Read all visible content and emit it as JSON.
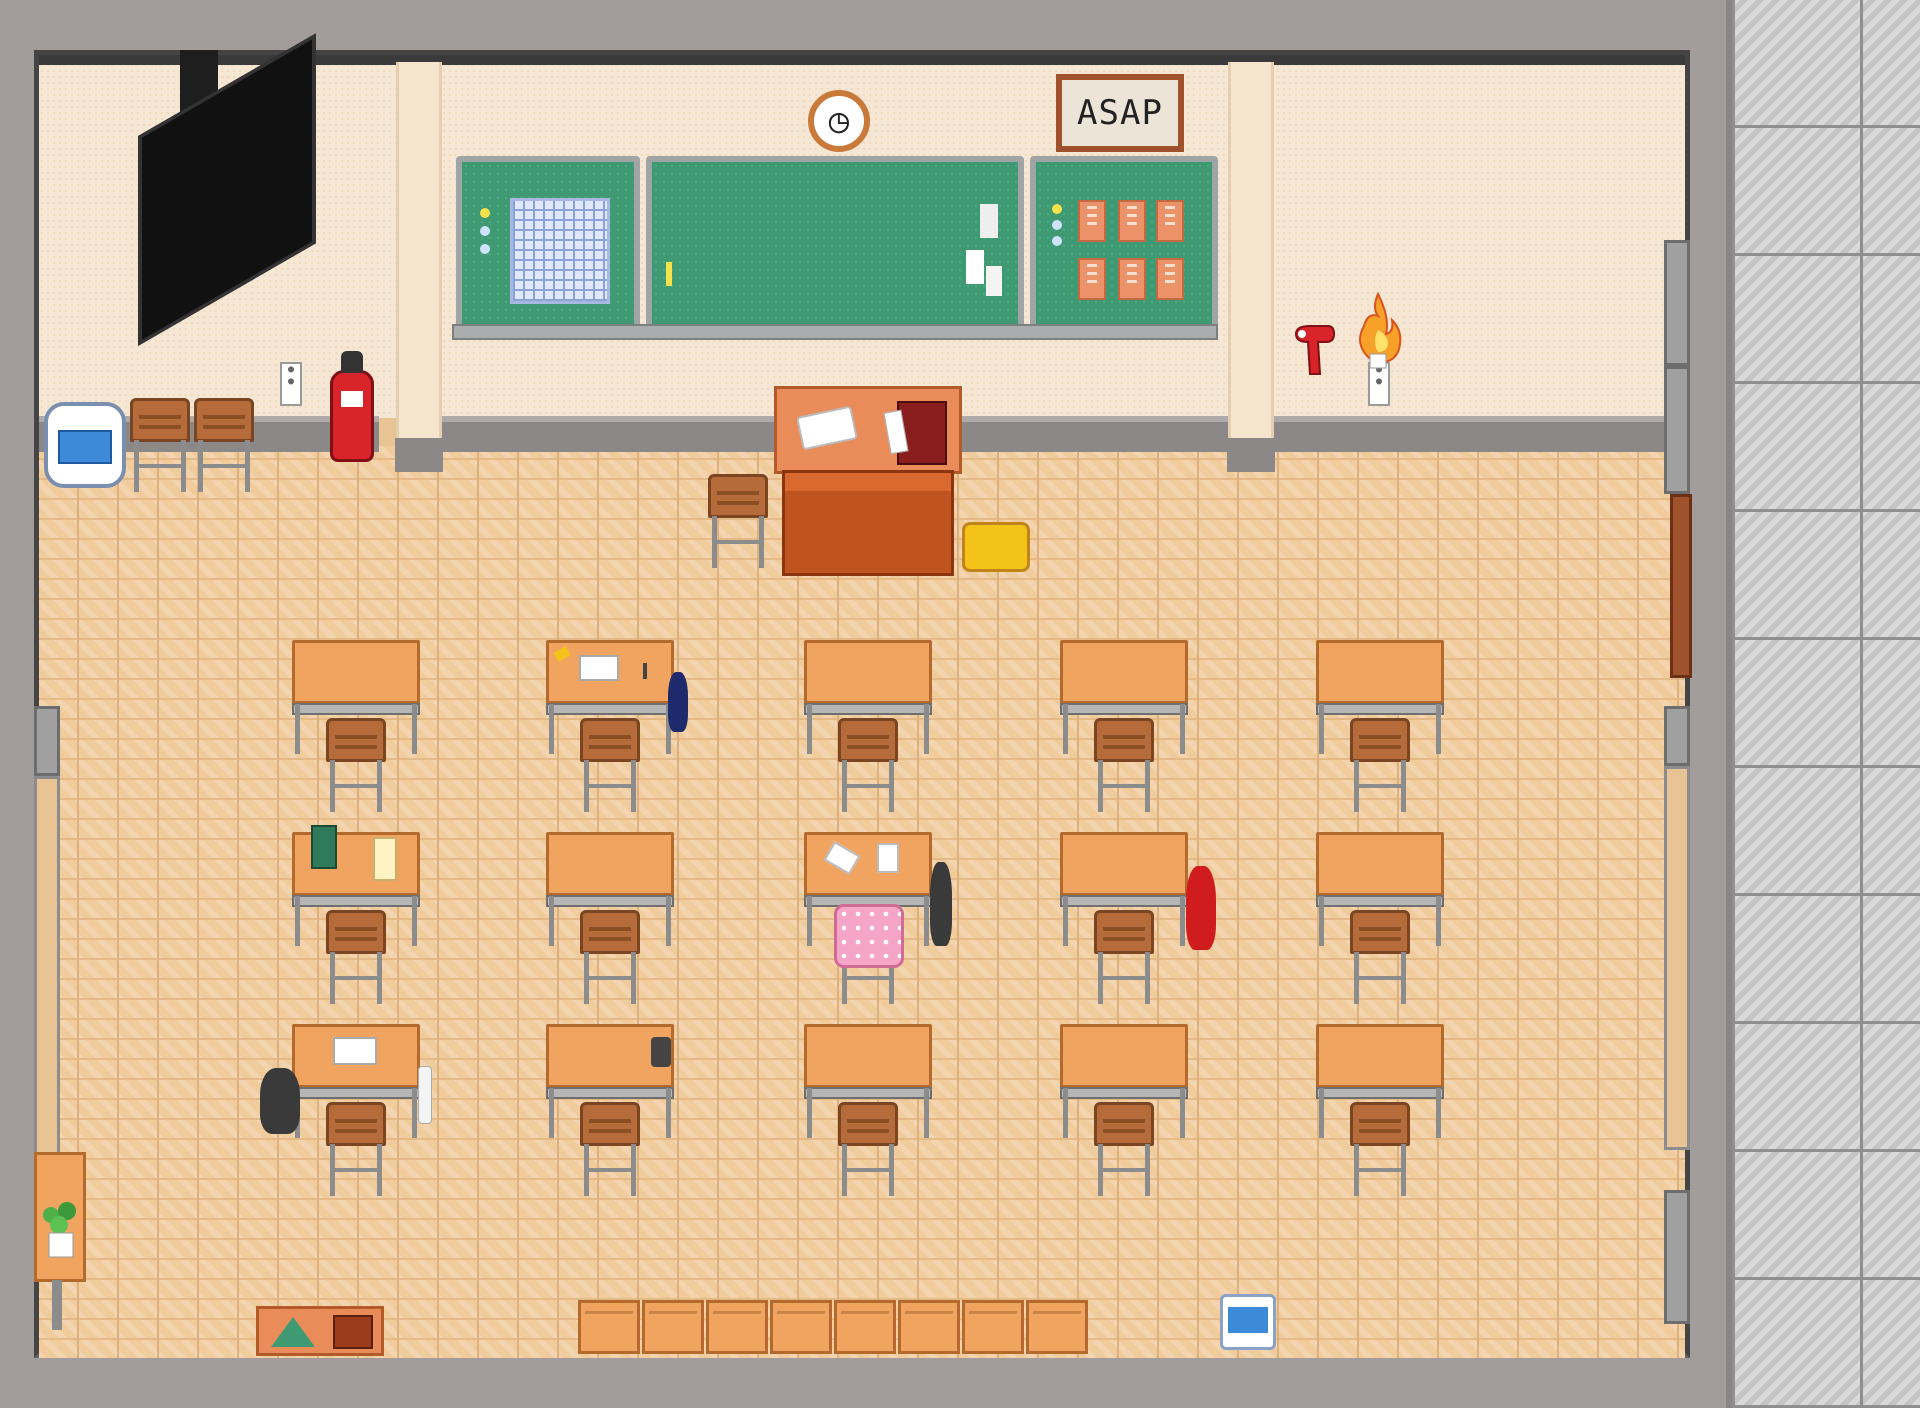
{
  "scene": {
    "name": "classroom",
    "sign_text": "ASAP",
    "clock_glyph": "◷",
    "colors": {
      "floor": "#f0cb9c",
      "wall": "#f6e7d4",
      "board": "#3f9a73",
      "desk": "#f1a45f",
      "chair": "#b56c3a",
      "extinguisher": "#d8232a",
      "hallway": "#c4c4c4"
    }
  },
  "student_desks": {
    "rows": 3,
    "columns": 5
  },
  "items": {
    "extinguisher_icon": "fire-extinguisher-icon",
    "fire_icon": "flame-icon",
    "hairdryer_icon": "hairdryer-icon",
    "tv_icon": "wall-tv-icon",
    "plant_icon": "potted-plant-icon",
    "cooler_icon": "water-cooler-icon"
  }
}
